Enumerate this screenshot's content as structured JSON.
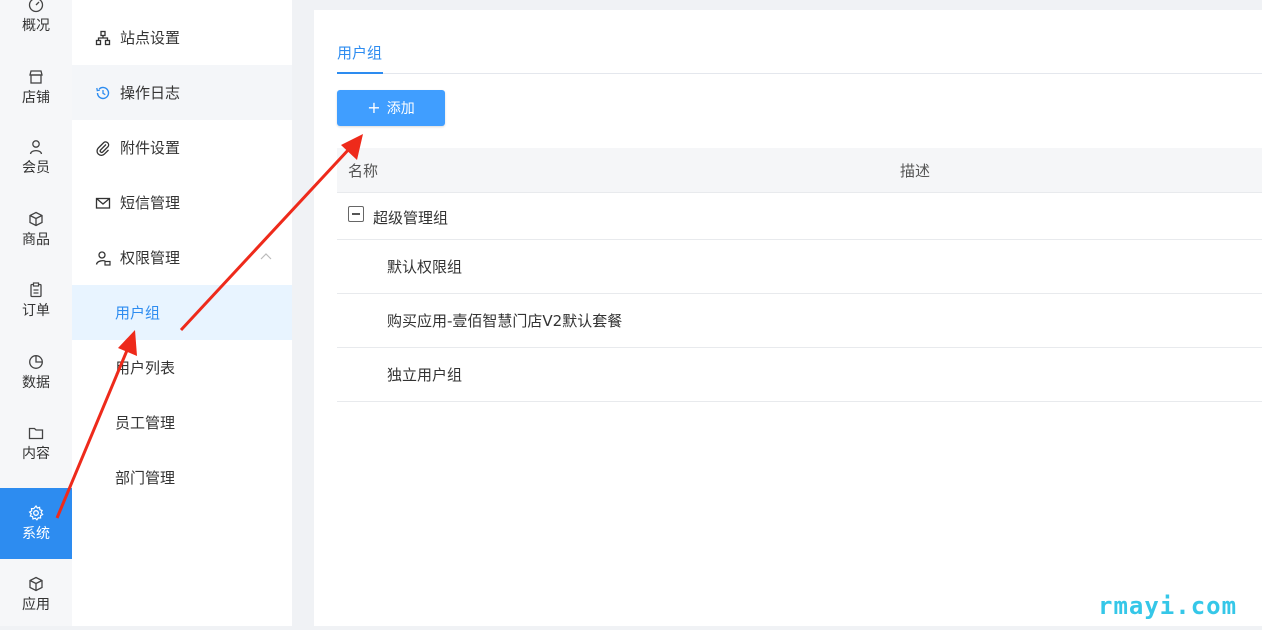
{
  "rail": {
    "items": [
      {
        "label": "概况",
        "icon": "dashboard-icon"
      },
      {
        "label": "店铺",
        "icon": "shop-icon"
      },
      {
        "label": "会员",
        "icon": "user-icon"
      },
      {
        "label": "商品",
        "icon": "box-icon"
      },
      {
        "label": "订单",
        "icon": "clipboard-icon"
      },
      {
        "label": "数据",
        "icon": "pie-chart-icon"
      },
      {
        "label": "内容",
        "icon": "folder-icon"
      },
      {
        "label": "系统",
        "icon": "gear-icon"
      },
      {
        "label": "应用",
        "icon": "cube-icon"
      }
    ],
    "active_index": 7
  },
  "submenu": {
    "items": [
      {
        "label": "站点设置",
        "icon": "sitemap-icon"
      },
      {
        "label": "操作日志",
        "icon": "history-icon"
      },
      {
        "label": "附件设置",
        "icon": "paperclip-icon"
      },
      {
        "label": "短信管理",
        "icon": "mail-icon"
      },
      {
        "label": "权限管理",
        "icon": "user-lock-icon"
      }
    ],
    "children": [
      {
        "label": "用户组"
      },
      {
        "label": "用户列表"
      },
      {
        "label": "员工管理"
      },
      {
        "label": "部门管理"
      }
    ],
    "active_child": "用户组"
  },
  "main": {
    "tab": "用户组",
    "add_button": "添加",
    "table": {
      "columns": [
        "名称",
        "描述"
      ],
      "rows": [
        {
          "name": "超级管理组",
          "level": 0,
          "expanded": true
        },
        {
          "name": "默认权限组",
          "level": 1
        },
        {
          "name": "购买应用-壹佰智慧门店V2默认套餐",
          "level": 1
        },
        {
          "name": "独立用户组",
          "level": 1
        }
      ]
    }
  },
  "watermark": "rmayi.com",
  "colors": {
    "accent": "#2d8cf0",
    "button": "#409eff",
    "annotation_arrow": "#ee2a1b",
    "watermark": "#35c7e8"
  }
}
